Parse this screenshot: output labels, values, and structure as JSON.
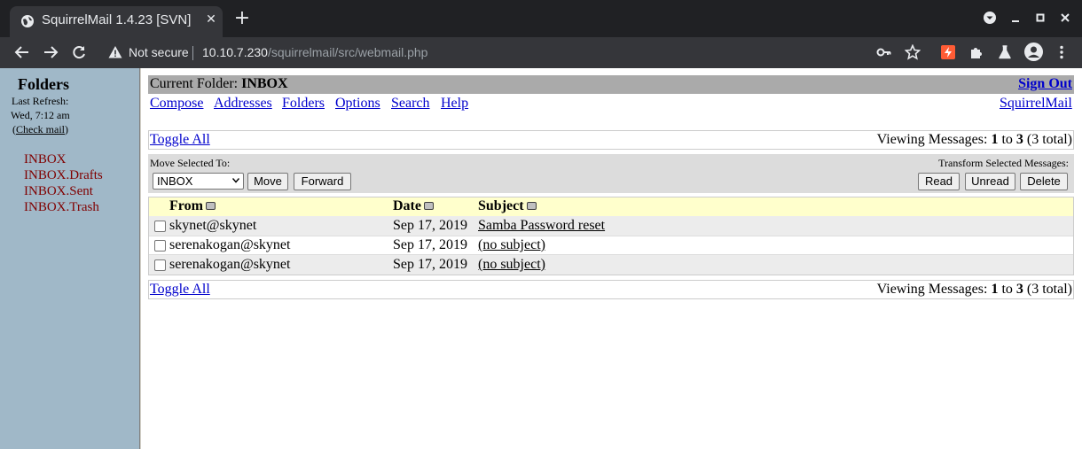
{
  "browser": {
    "tab_title": "SquirrelMail 1.4.23 [SVN]",
    "security_label": "Not secure",
    "url_host": "10.10.7.230",
    "url_path": "/squirrelmail/src/webmail.php",
    "colors": {
      "tabbar": "#202124",
      "toolbar": "#35363a",
      "text": "#e8eaed"
    }
  },
  "sidebar": {
    "title": "Folders",
    "last_refresh_label": "Last Refresh:",
    "last_refresh_time": "Wed, 7:12 am",
    "check_mail_open": "(",
    "check_mail_label": "Check mail",
    "check_mail_close": ")",
    "folders": [
      {
        "label": "INBOX"
      },
      {
        "label": "INBOX.Drafts"
      },
      {
        "label": "INBOX.Sent"
      },
      {
        "label": "INBOX.Trash"
      }
    ],
    "colors": {
      "background": "#a0b8c8",
      "folder_link": "#800000"
    }
  },
  "header": {
    "current_folder_label": "Current Folder:",
    "current_folder_name": "INBOX",
    "sign_out": "Sign Out",
    "menu": [
      {
        "label": "Compose"
      },
      {
        "label": "Addresses"
      },
      {
        "label": "Folders"
      },
      {
        "label": "Options"
      },
      {
        "label": "Search"
      },
      {
        "label": "Help"
      }
    ],
    "brand_link": "SquirrelMail"
  },
  "pager": {
    "toggle_all": "Toggle All",
    "viewing_prefix": "Viewing Messages:",
    "from": "1",
    "to_word": "to",
    "to": "3",
    "total": "(3 total)"
  },
  "actions": {
    "move_label": "Move Selected To:",
    "move_target": "INBOX",
    "move_button": "Move",
    "forward_button": "Forward",
    "transform_label": "Transform Selected Messages:",
    "read_button": "Read",
    "unread_button": "Unread",
    "delete_button": "Delete"
  },
  "messages": {
    "columns": {
      "from": "From",
      "date": "Date",
      "subject": "Subject"
    },
    "rows": [
      {
        "from": "skynet@skynet",
        "date": "Sep 17, 2019",
        "subject": "Samba Password reset"
      },
      {
        "from": "serenakogan@skynet",
        "date": "Sep 17, 2019",
        "subject": "(no subject)"
      },
      {
        "from": "serenakogan@skynet",
        "date": "Sep 17, 2019",
        "subject": "(no subject)"
      }
    ],
    "colors": {
      "header": "#ffffcc",
      "alt_row": "#ececec",
      "link": "#0000cc"
    }
  }
}
